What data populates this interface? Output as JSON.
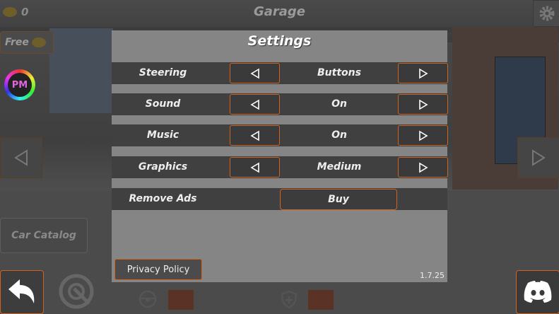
{
  "header": {
    "title": "Garage",
    "coins": "0"
  },
  "free_button": {
    "label": "Free"
  },
  "logo": {
    "text": "PM"
  },
  "car_catalog": {
    "label": "Car Catalog"
  },
  "settings": {
    "title": "Settings",
    "rows": [
      {
        "label": "Steering",
        "value": "Buttons"
      },
      {
        "label": "Sound",
        "value": "On"
      },
      {
        "label": "Music",
        "value": "On"
      },
      {
        "label": "Graphics",
        "value": "Medium"
      }
    ],
    "remove_ads": {
      "label": "Remove Ads",
      "button": "Buy"
    },
    "privacy_policy": "Privacy Policy",
    "version": "1.7.25"
  },
  "icons": {
    "coin": "coin-icon",
    "gear": "gear-icon",
    "back": "back-arrow-icon",
    "tune": "wheel-wrench-icon",
    "discord": "discord-icon",
    "steering": "steering-wheel-icon",
    "shield": "shield-plus-icon"
  },
  "colors": {
    "accent": "#d0641c",
    "dialog_bg": "#858585",
    "row_bg": "#404040"
  }
}
